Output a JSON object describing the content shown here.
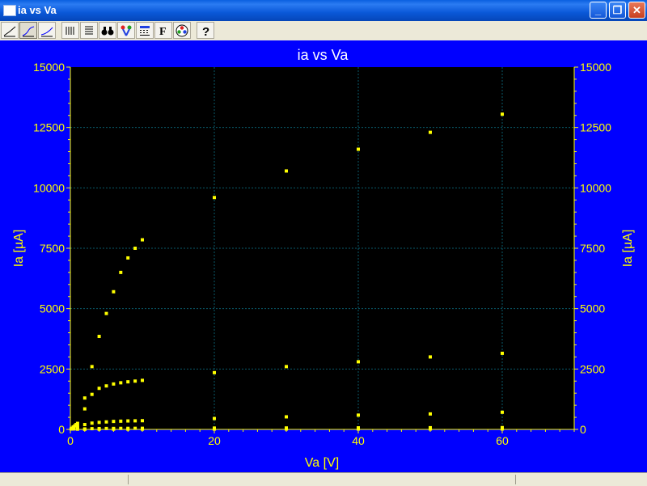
{
  "window": {
    "title": "ia vs Va",
    "controls": {
      "minimize": "_",
      "restore": "❐",
      "close": "✕"
    }
  },
  "toolbar": {
    "buttons": [
      "line-plot-icon",
      "line-plot-2-icon",
      "line-plot-3-icon",
      "vertical-bars-icon",
      "horizontal-lines-icon",
      "binoculars-icon",
      "marker-icon",
      "data-table-icon",
      "font-icon",
      "color-palette-icon",
      "help-icon"
    ]
  },
  "chart_data": {
    "type": "scatter",
    "title": "ia vs Va",
    "xlabel": "Va [V]",
    "ylabel": "Ia [µA]",
    "ylabel_right": "Ia [µA]",
    "xlim": [
      0,
      70
    ],
    "ylim": [
      0,
      15000
    ],
    "xticks": [
      0,
      20,
      40,
      60
    ],
    "yticks": [
      0,
      2500,
      5000,
      7500,
      10000,
      12500,
      15000
    ],
    "ytick_labels": [
      "0",
      "2500",
      "5000",
      "7500",
      "10000",
      "12500",
      "15000"
    ],
    "grid": true,
    "colors": {
      "background": "#0000ff",
      "plot_area": "#000000",
      "text": "#ffff00",
      "marker": "#ffff00",
      "grid": "#0a5a6a",
      "title": "#ffffff"
    },
    "series": [
      {
        "points": [
          [
            0.1,
            20
          ],
          [
            0.2,
            50
          ],
          [
            0.4,
            100
          ],
          [
            0.6,
            150
          ],
          [
            0.8,
            200
          ],
          [
            1,
            250
          ],
          [
            2,
            850
          ],
          [
            3,
            1450
          ],
          [
            4,
            3850
          ],
          [
            5,
            4800
          ],
          [
            6,
            5700
          ],
          [
            7,
            6500
          ],
          [
            8,
            7100
          ],
          [
            9,
            7500
          ],
          [
            10,
            7850
          ],
          [
            20,
            9600
          ],
          [
            30,
            10700
          ],
          [
            40,
            11600
          ],
          [
            50,
            12300
          ],
          [
            60,
            13050
          ]
        ]
      },
      {
        "points": [
          [
            0.2,
            20
          ],
          [
            0.5,
            60
          ],
          [
            1,
            130
          ],
          [
            2,
            1300
          ],
          [
            3,
            2600
          ],
          [
            4,
            1700
          ],
          [
            5,
            1800
          ],
          [
            6,
            1880
          ],
          [
            7,
            1930
          ],
          [
            8,
            1970
          ],
          [
            9,
            2000
          ],
          [
            10,
            2030
          ],
          [
            20,
            2350
          ],
          [
            30,
            2600
          ],
          [
            40,
            2800
          ],
          [
            50,
            3000
          ],
          [
            60,
            3150
          ]
        ]
      },
      {
        "points": [
          [
            0.5,
            20
          ],
          [
            1,
            60
          ],
          [
            2,
            200
          ],
          [
            3,
            260
          ],
          [
            4,
            290
          ],
          [
            5,
            310
          ],
          [
            6,
            330
          ],
          [
            7,
            340
          ],
          [
            8,
            350
          ],
          [
            9,
            355
          ],
          [
            10,
            360
          ],
          [
            20,
            450
          ],
          [
            30,
            520
          ],
          [
            40,
            590
          ],
          [
            50,
            640
          ],
          [
            60,
            710
          ]
        ]
      },
      {
        "points": [
          [
            1,
            10
          ],
          [
            2,
            20
          ],
          [
            3,
            30
          ],
          [
            4,
            35
          ],
          [
            5,
            38
          ],
          [
            6,
            40
          ],
          [
            7,
            42
          ],
          [
            8,
            44
          ],
          [
            9,
            45
          ],
          [
            10,
            46
          ],
          [
            20,
            55
          ],
          [
            30,
            60
          ],
          [
            40,
            65
          ],
          [
            50,
            70
          ],
          [
            60,
            75
          ]
        ]
      },
      {
        "points": [
          [
            2,
            5
          ],
          [
            4,
            8
          ],
          [
            6,
            10
          ],
          [
            8,
            11
          ],
          [
            10,
            12
          ],
          [
            20,
            14
          ],
          [
            30,
            15
          ],
          [
            40,
            16
          ],
          [
            50,
            17
          ],
          [
            60,
            18
          ]
        ]
      }
    ]
  }
}
